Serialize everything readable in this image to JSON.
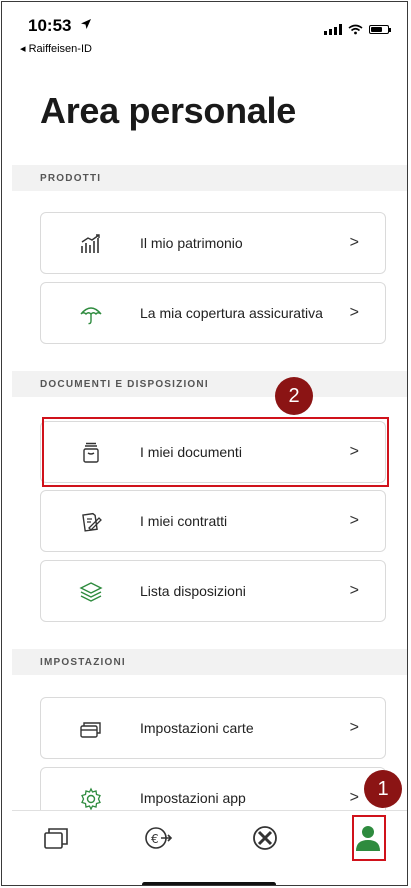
{
  "status": {
    "time": "10:53",
    "back_label": "◂ Raiffeisen-ID"
  },
  "page_title": "Area personale",
  "sections": [
    {
      "header": "PRODOTTI",
      "items": [
        {
          "label": "Il mio patrimonio",
          "icon": "chart-growth-icon"
        },
        {
          "label": "La mia copertura assicurativa",
          "icon": "umbrella-icon"
        }
      ]
    },
    {
      "header": "DOCUMENTI E DISPOSIZIONI",
      "items": [
        {
          "label": "I miei documenti",
          "icon": "document-box-icon"
        },
        {
          "label": "I miei contratti",
          "icon": "contract-sign-icon"
        },
        {
          "label": "Lista disposizioni",
          "icon": "layers-icon"
        }
      ]
    },
    {
      "header": "IMPOSTAZIONI",
      "items": [
        {
          "label": "Impostazioni carte",
          "icon": "cards-icon"
        },
        {
          "label": "Impostazioni app",
          "icon": "gear-icon"
        }
      ]
    }
  ],
  "chevron": ">",
  "annotations": {
    "badge_1": "1",
    "badge_2": "2"
  },
  "tabbar": {
    "active_color": "#2e8b3e",
    "tabs": [
      "cards-tab",
      "payments-tab",
      "raiffeisen-tab",
      "profile-tab"
    ]
  },
  "colors": {
    "highlight": "#d0121b",
    "badge": "#8b1414"
  }
}
